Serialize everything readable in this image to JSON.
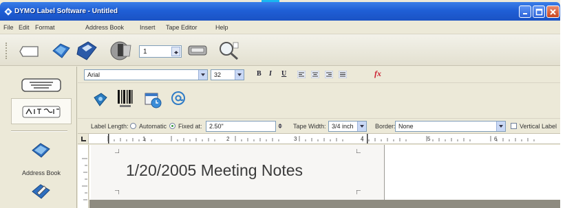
{
  "window": {
    "title": "DYMO Label Software - Untitled"
  },
  "menu": [
    "File",
    "Edit",
    "Format",
    "Address Book",
    "Insert",
    "Tape Editor",
    "Help"
  ],
  "main_toolbar": {
    "copies_value": "1"
  },
  "left_pane": {
    "address_book_label": "Address Book"
  },
  "format_bar": {
    "font_name": "Arial",
    "font_size": "32",
    "bold_label": "B",
    "italic_label": "I",
    "underline_label": "U",
    "fx_label": "fx"
  },
  "properties": {
    "label_length_label": "Label Length:",
    "automatic_label": "Automatic",
    "fixed_at_label": "Fixed at:",
    "fixed_at_value": "2.50\"",
    "tape_width_label": "Tape Width:",
    "tape_width_value": "3/4 inch",
    "border_label": "Border:",
    "border_value": "None",
    "vertical_label": "Vertical Label"
  },
  "ruler": {
    "numbers": [
      "1",
      "2",
      "3",
      "4",
      "5",
      "6"
    ]
  },
  "label": {
    "text": "1/20/2005 Meeting Notes"
  },
  "colors": {
    "titlebar": "#1f5fd6",
    "chrome": "#ece9d8",
    "accent_cyan": "#19b7f0"
  }
}
